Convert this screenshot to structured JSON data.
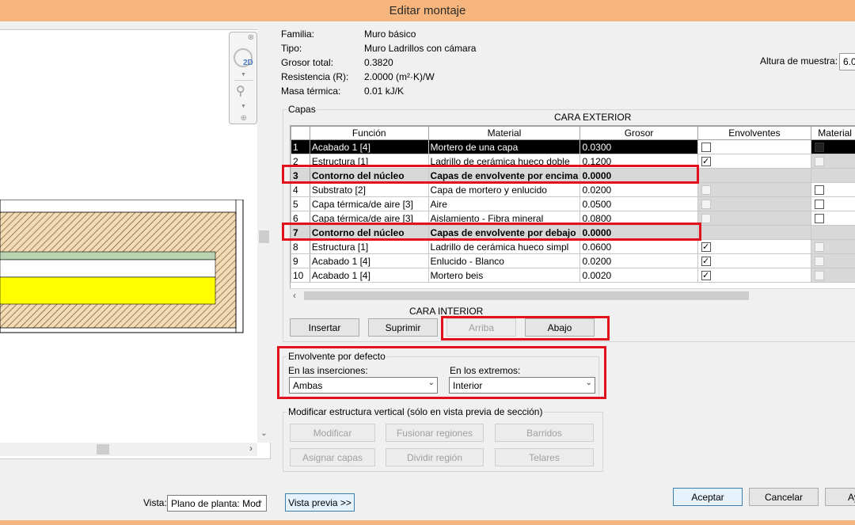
{
  "window": {
    "title": "Editar montaje"
  },
  "info": {
    "family_label": "Familia:",
    "family_value": "Muro básico",
    "type_label": "Tipo:",
    "type_value": "Muro Ladrillos con cámara",
    "thickness_label": "Grosor total:",
    "thickness_value": "0.3820",
    "resistance_label": "Resistencia (R):",
    "resistance_value": "2.0000 (m²·K)/W",
    "mass_label": "Masa térmica:",
    "mass_value": "0.01 kJ/K",
    "sample_height_label": "Altura de muestra:",
    "sample_height_value": "6.0"
  },
  "layers": {
    "group_title": "Capas",
    "exterior_label": "CARA EXTERIOR",
    "interior_label": "CARA INTERIOR",
    "columns": [
      "Función",
      "Material",
      "Grosor",
      "Envolventes",
      "Material"
    ],
    "rows": [
      {
        "n": "1",
        "function": "Acabado 1 [4]",
        "material": "Mortero de una capa",
        "thickness": "0.0300"
      },
      {
        "n": "2",
        "function": "Estructura [1]",
        "material": "Ladrillo de cerámica hueco doble",
        "thickness": "0.1200"
      },
      {
        "n": "3",
        "function": "Contorno del núcleo",
        "material": "Capas de envolvente por encima",
        "thickness": "0.0000"
      },
      {
        "n": "4",
        "function": "Substrato [2]",
        "material": "Capa de mortero y enlucido",
        "thickness": "0.0200"
      },
      {
        "n": "5",
        "function": "Capa térmica/de aire [3]",
        "material": "Aire",
        "thickness": "0.0500"
      },
      {
        "n": "6",
        "function": "Capa térmica/de aire [3]",
        "material": "Aislamiento - Fibra mineral",
        "thickness": "0.0800"
      },
      {
        "n": "7",
        "function": "Contorno del núcleo",
        "material": "Capas de envolvente por debajo",
        "thickness": "0.0000"
      },
      {
        "n": "8",
        "function": "Estructura [1]",
        "material": "Ladrillo de cerámica hueco simpl",
        "thickness": "0.0600"
      },
      {
        "n": "9",
        "function": "Acabado 1 [4]",
        "material": "Enlucido - Blanco",
        "thickness": "0.0200"
      },
      {
        "n": "10",
        "function": "Acabado 1 [4]",
        "material": "Mortero beis",
        "thickness": "0.0020"
      }
    ],
    "buttons": {
      "insert": "Insertar",
      "delete": "Suprimir",
      "up": "Arriba",
      "down": "Abajo"
    }
  },
  "wrapping": {
    "group_title": "Envolvente por defecto",
    "inserts_label": "En las inserciones:",
    "inserts_value": "Ambas",
    "ends_label": "En los extremos:",
    "ends_value": "Interior"
  },
  "vertical": {
    "group_title": "Modificar estructura vertical (sólo en vista previa de sección)",
    "buttons": [
      "Modificar",
      "Fusionar regiones",
      "Barridos",
      "Asignar capas",
      "Dividir región",
      "Telares"
    ]
  },
  "footer": {
    "view_label": "Vista:",
    "view_value": "Plano de planta: Mod",
    "preview_button": "Vista previa >>",
    "ok": "Aceptar",
    "cancel": "Cancelar",
    "help": "Ay"
  },
  "navwheel": {
    "mode_label": "2D"
  },
  "colors": {
    "highlight_red": "#e1111d",
    "title_bar": "#f6b57d",
    "insulation_yellow": "#ffff00",
    "air_green": "#b9d4b0"
  }
}
